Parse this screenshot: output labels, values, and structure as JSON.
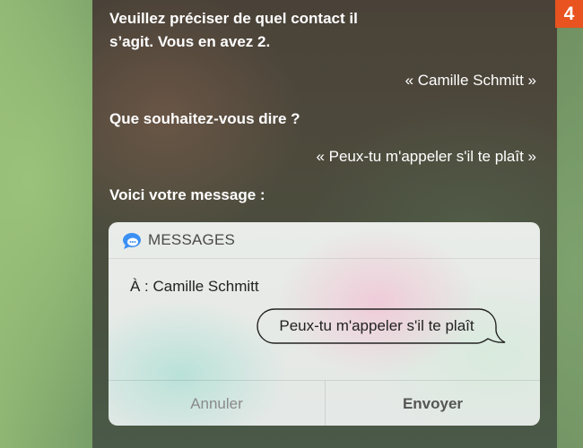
{
  "siri": {
    "prompt_line1": "Veuillez préciser de quel contact il",
    "prompt_line2": "s’agit. Vous en avez 2.",
    "user_reply_contact": "« Camille Schmitt »",
    "question_message": "Que souhaitez-vous dire ?",
    "user_reply_message": "« Peux-tu m'appeler s'il te plaît »",
    "confirmation": "Voici votre message :"
  },
  "step_badge": "4",
  "message_card": {
    "app_title": "MESSAGES",
    "icon": "messages-bubble-icon",
    "recipient": "À : Camille Schmitt",
    "message_text": "Peux-tu m'appeler s'il te plaît",
    "cancel_label": "Annuler",
    "send_label": "Envoyer"
  },
  "colors": {
    "badge": "#e8531f",
    "messages_icon": "#3b8ff3"
  }
}
